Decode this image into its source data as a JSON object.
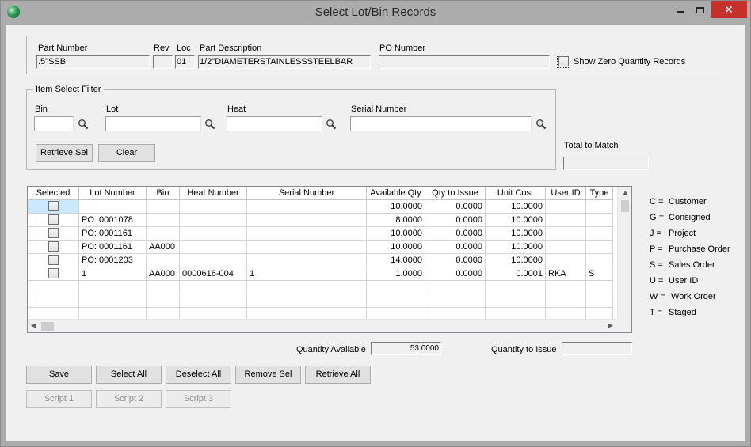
{
  "window": {
    "title": "Select Lot/Bin Records"
  },
  "part": {
    "part_number_label": "Part Number",
    "part_number": ".5\"SSB",
    "rev_label": "Rev",
    "rev": "",
    "loc_label": "Loc",
    "loc": "01",
    "desc_label": "Part Description",
    "desc": "1/2\"DIAMETERSTAINLESSSTEELBAR",
    "po_label": "PO Number",
    "po": "",
    "show_zero_label": "Show Zero Quantity Records"
  },
  "filter": {
    "title": "Item Select Filter",
    "bin_label": "Bin",
    "lot_label": "Lot",
    "heat_label": "Heat",
    "serial_label": "Serial Number",
    "retrieve_sel": "Retrieve Sel",
    "clear": "Clear"
  },
  "total_to_match_label": "Total to Match",
  "grid": {
    "columns": [
      "Selected",
      "Lot Number",
      "Bin",
      "Heat Number",
      "Serial Number",
      "Available Qty",
      "Qty to Issue",
      "Unit Cost",
      "User ID",
      "Type"
    ],
    "rows": [
      {
        "lot": "",
        "bin": "",
        "heat": "",
        "serial": "",
        "avail": "10.0000",
        "issue": "0.0000",
        "cost": "10.0000",
        "user": "",
        "type": ""
      },
      {
        "lot": "PO: 0001078",
        "bin": "",
        "heat": "",
        "serial": "",
        "avail": "8.0000",
        "issue": "0.0000",
        "cost": "10.0000",
        "user": "",
        "type": ""
      },
      {
        "lot": "PO: 0001161",
        "bin": "",
        "heat": "",
        "serial": "",
        "avail": "10.0000",
        "issue": "0.0000",
        "cost": "10.0000",
        "user": "",
        "type": ""
      },
      {
        "lot": "PO: 0001161",
        "bin": "AA000",
        "heat": "",
        "serial": "",
        "avail": "10.0000",
        "issue": "0.0000",
        "cost": "10.0000",
        "user": "",
        "type": ""
      },
      {
        "lot": "PO: 0001203",
        "bin": "",
        "heat": "",
        "serial": "",
        "avail": "14.0000",
        "issue": "0.0000",
        "cost": "10.0000",
        "user": "",
        "type": ""
      },
      {
        "lot": "1",
        "bin": "AA000",
        "heat": "0000616-004",
        "serial": "1",
        "avail": "1.0000",
        "issue": "0.0000",
        "cost": "0.0001",
        "user": "RKA",
        "type": "S"
      }
    ]
  },
  "legend": [
    {
      "key": "C =",
      "label": "Customer"
    },
    {
      "key": "G =",
      "label": "Consigned"
    },
    {
      "key": "J =",
      "label": "Project"
    },
    {
      "key": "P =",
      "label": "Purchase Order"
    },
    {
      "key": "S =",
      "label": "Sales Order"
    },
    {
      "key": "U =",
      "label": "User ID"
    },
    {
      "key": "W =",
      "label": " Work Order"
    },
    {
      "key": "T =",
      "label": "Staged"
    }
  ],
  "totals": {
    "qty_available_label": "Quantity Available",
    "qty_available": "53.0000",
    "qty_issue_label": "Quantity to Issue",
    "qty_issue": ""
  },
  "buttons": {
    "save": "Save",
    "select_all": "Select All",
    "deselect_all": "Deselect All",
    "remove_sel": "Remove Sel",
    "retrieve_all": "Retrieve All"
  },
  "scripts": {
    "script1": "Script 1",
    "script2": "Script 2",
    "script3": "Script 3"
  }
}
